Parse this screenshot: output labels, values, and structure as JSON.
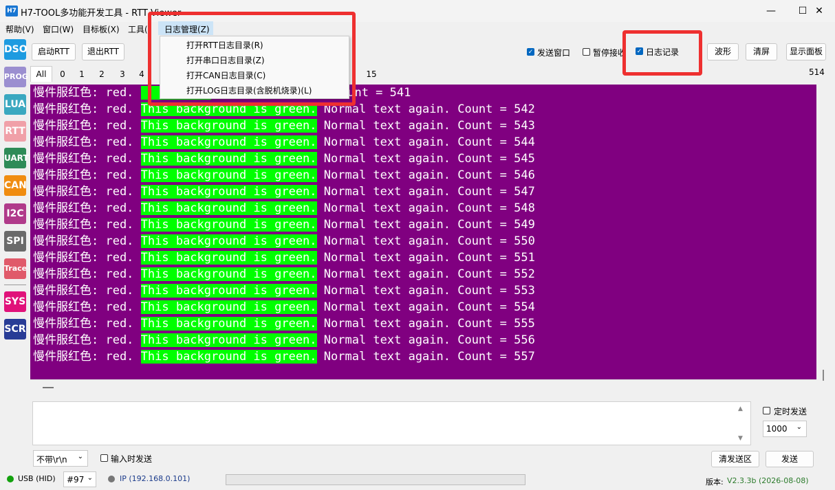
{
  "window": {
    "app_icon": "H7",
    "title": "H7-TOOL多功能开发工具 - RTT Viewer",
    "minimize": "—",
    "maximize": "☐",
    "close": "✕"
  },
  "menubar": {
    "items": [
      "帮助(V)",
      "窗口(W)",
      "目标板(X)",
      "工具(",
      "日志管理(Z)"
    ]
  },
  "dropdown": {
    "items": [
      "打开RTT日志目录(R)",
      "打开串口日志目录(Z)",
      "打开CAN日志目录(C)",
      "打开LOG日志目录(含脱机烧录)(L)"
    ]
  },
  "sidebar": {
    "items": [
      {
        "label": "DSO",
        "color": "#1e9be0"
      },
      {
        "label": "PROG",
        "color": "#9b8fd0"
      },
      {
        "label": "LUA",
        "color": "#3aa8c0"
      },
      {
        "label": "RTT",
        "color": "#f0a0a8"
      },
      {
        "label": "UART",
        "color": "#2e8b57"
      },
      {
        "label": "CAN",
        "color": "#f08c10"
      },
      {
        "label": "I2C",
        "color": "#b03a8a"
      },
      {
        "label": "SPI",
        "color": "#6a6a6a"
      },
      {
        "label": "Trace",
        "color": "#e05a6a"
      },
      {
        "label": "SYS",
        "color": "#e0127a"
      },
      {
        "label": "SCR",
        "color": "#283c96"
      }
    ]
  },
  "toolbar": {
    "start_rtt": "启动RTT",
    "exit_rtt": "退出RTT",
    "send_window": "发送窗口",
    "pause_receive": "暂停接收",
    "log_record": "日志记录",
    "waveform": "波形",
    "clear": "清屏",
    "show_panel": "显示面板"
  },
  "tabs": [
    "All",
    "0",
    "1",
    "2",
    "3",
    "4",
    "15"
  ],
  "counter": "514",
  "log": {
    "prefix": "慢件服红色: red. ",
    "green_text": "This background is green.",
    "suffix_pre": " Normal text again. Count = ",
    "first_visible_partial": "mal text again. Count = 541",
    "counts": [
      542,
      543,
      544,
      545,
      546,
      547,
      548,
      549,
      550,
      551,
      552,
      553,
      554,
      555,
      556,
      557
    ]
  },
  "bottom": {
    "timed_send": "定时发送",
    "interval": "1000",
    "line_ending": "不带\\r\\n",
    "send_on_input": "输入时发送",
    "clear_send": "清发送区",
    "send": "发送"
  },
  "status": {
    "usb": "USB (HID)",
    "port": "#97",
    "ip": "IP (192.168.0.101)",
    "version_label": "版本:",
    "version": "V2.3.3b (2026-08-08)"
  },
  "colors": {
    "log_bg": "#800080",
    "green_bg": "#00ff00",
    "highlight": "#ee3030"
  }
}
